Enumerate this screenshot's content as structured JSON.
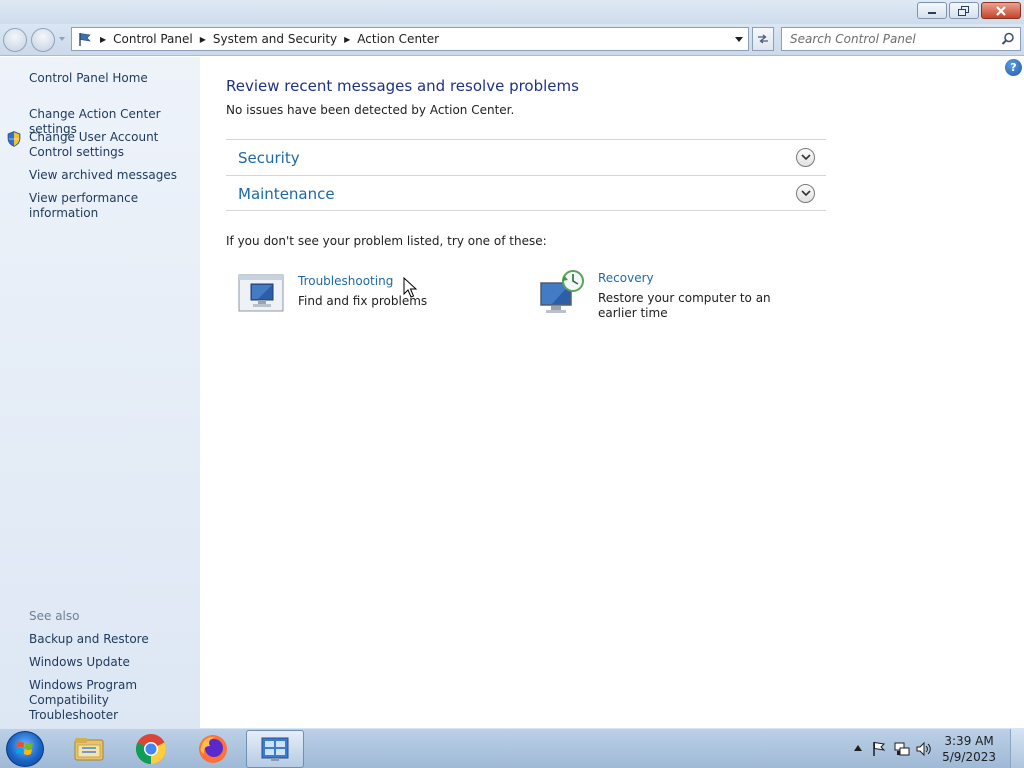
{
  "breadcrumb": [
    "Control Panel",
    "System and Security",
    "Action Center"
  ],
  "search": {
    "placeholder": "Search Control Panel"
  },
  "sidebar": {
    "home": "Control Panel Home",
    "links": [
      "Change Action Center settings",
      "Change User Account Control settings",
      "View archived messages",
      "View performance information"
    ],
    "see_also_label": "See also",
    "see_also": [
      "Backup and Restore",
      "Windows Update",
      "Windows Program Compatibility Troubleshooter"
    ]
  },
  "main": {
    "title": "Review recent messages and resolve problems",
    "status": "No issues have been detected by Action Center.",
    "sections": [
      "Security",
      "Maintenance"
    ],
    "hint": "If you don't see your problem listed, try one of these:",
    "tools": [
      {
        "title": "Troubleshooting",
        "description": "Find and fix problems",
        "icon": "troubleshooting-icon"
      },
      {
        "title": "Recovery",
        "description": "Restore your computer to an earlier time",
        "icon": "recovery-icon"
      }
    ],
    "help_glyph": "?"
  },
  "taskbar": {
    "apps": [
      "start-orb",
      "file-explorer-icon",
      "chrome-icon",
      "firefox-icon",
      "control-panel-icon"
    ],
    "clock": {
      "time": "3:39 AM",
      "date": "5/9/2023"
    }
  },
  "colors": {
    "link": "#1e6aa5",
    "title": "#1e3287",
    "sidebar_link": "#1e395b"
  }
}
